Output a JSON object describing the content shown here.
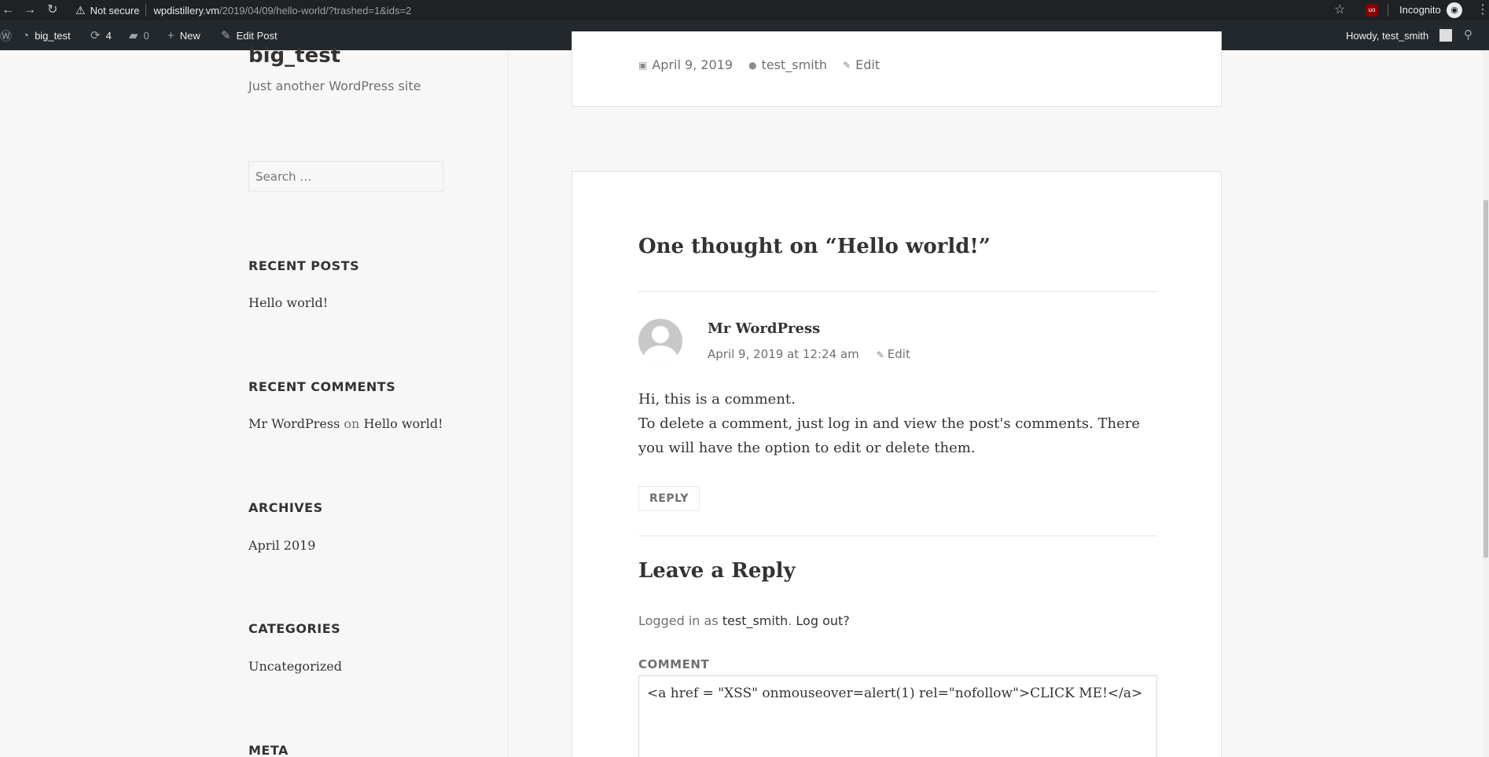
{
  "browser": {
    "back_icon": "arrow-left-icon",
    "forward_icon": "arrow-right-icon",
    "reload_icon": "reload-icon",
    "security_text": "Not secure",
    "url_host": "wpdistillery.vm",
    "url_path": "/2019/04/09/hello-world/?trashed=1&ids=2",
    "incognito_label": "Incognito"
  },
  "admin_bar": {
    "site_name": "big_test",
    "updates_count": "4",
    "comments_count": "0",
    "new_label": "New",
    "edit_post_label": "Edit Post",
    "howdy": "Howdy, test_smith"
  },
  "sidebar": {
    "site_title": "big_test",
    "site_description": "Just another WordPress site",
    "search_placeholder": "Search …",
    "recent_posts_title": "RECENT POSTS",
    "recent_posts": [
      "Hello world!"
    ],
    "recent_comments_title": "RECENT COMMENTS",
    "recent_comment": {
      "author": "Mr WordPress",
      "on": "on",
      "post": "Hello world!"
    },
    "archives_title": "ARCHIVES",
    "archives": [
      "April 2019"
    ],
    "categories_title": "CATEGORIES",
    "categories": [
      "Uncategorized"
    ],
    "meta_title": "META"
  },
  "post": {
    "date": "April 9, 2019",
    "author": "test_smith",
    "edit_label": "Edit"
  },
  "comments": {
    "title": "One thought on “Hello world!”",
    "author": "Mr WordPress",
    "date": "April 9, 2019 at 12:24 am",
    "edit_label": "Edit",
    "text_line1": "Hi, this is a comment.",
    "text_line2": "To delete a comment, just log in and view the post's comments. There you will have the option to edit or delete them.",
    "reply_label": "REPLY"
  },
  "reply_form": {
    "title": "Leave a Reply",
    "logged_in_prefix": "Logged in as",
    "user": "test_smith",
    "logout": "Log out?",
    "comment_label": "COMMENT",
    "comment_value": "<a href = \"XSS\" onmouseover=alert(1) rel=\"nofollow\">CLICK ME!</a>"
  }
}
